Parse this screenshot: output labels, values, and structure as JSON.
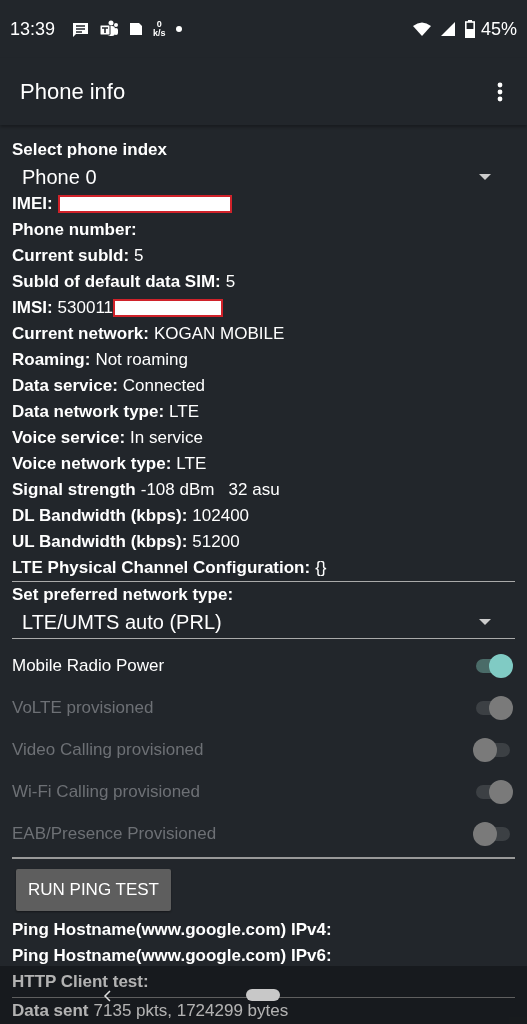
{
  "status_bar": {
    "time": "13:39",
    "net_speed_value": "0",
    "net_speed_unit": "k/s",
    "battery": "45%"
  },
  "app_bar": {
    "title": "Phone info"
  },
  "phone_index": {
    "label": "Select phone index",
    "value": "Phone 0"
  },
  "info_rows": [
    {
      "label": "IMEI:",
      "value": "",
      "redacted": true
    },
    {
      "label": "Phone number:",
      "value": "",
      "redacted": false
    },
    {
      "label": "Current subId:",
      "value": "5",
      "redacted": false
    },
    {
      "label": "SubId of default data SIM:",
      "value": "5",
      "redacted": false
    },
    {
      "label": "IMSI:",
      "value": "530011",
      "redacted": true
    },
    {
      "label": "Current network:",
      "value": "KOGAN MOBILE",
      "redacted": false
    },
    {
      "label": "Roaming:",
      "value": "Not roaming",
      "redacted": false
    },
    {
      "label": "Data service:",
      "value": "Connected",
      "redacted": false
    },
    {
      "label": "Data network type:",
      "value": "LTE",
      "redacted": false
    },
    {
      "label": "Voice service:",
      "value": "In service",
      "redacted": false
    },
    {
      "label": "Voice network type:",
      "value": "LTE",
      "redacted": false
    },
    {
      "label": "Signal strength",
      "value": "-108 dBm   32 asu",
      "redacted": false
    },
    {
      "label": "DL Bandwidth (kbps):",
      "value": "102400",
      "redacted": false
    },
    {
      "label": "UL Bandwidth (kbps):",
      "value": "51200",
      "redacted": false
    },
    {
      "label": "LTE Physical Channel Configuration:",
      "value": "{}",
      "redacted": false
    }
  ],
  "network_type": {
    "label": "Set preferred network type:",
    "value": "LTE/UMTS auto (PRL)"
  },
  "switches": [
    {
      "label": "Mobile Radio Power",
      "on": true,
      "disabled": false
    },
    {
      "label": "VoLTE provisioned",
      "on": true,
      "disabled": true
    },
    {
      "label": "Video Calling provisioned",
      "on": false,
      "disabled": true
    },
    {
      "label": "Wi-Fi Calling provisioned",
      "on": true,
      "disabled": true
    },
    {
      "label": "EAB/Presence Provisioned",
      "on": false,
      "disabled": true
    }
  ],
  "ping_button": "RUN PING TEST",
  "ping_rows": [
    {
      "label": "Ping Hostname(www.google.com) IPv4:"
    },
    {
      "label": "Ping Hostname(www.google.com) IPv6:"
    }
  ],
  "http_test": {
    "label": "HTTP Client test:"
  },
  "data_sent": {
    "label": "Data sent",
    "value": "7135 pkts, 1724299 bytes"
  }
}
